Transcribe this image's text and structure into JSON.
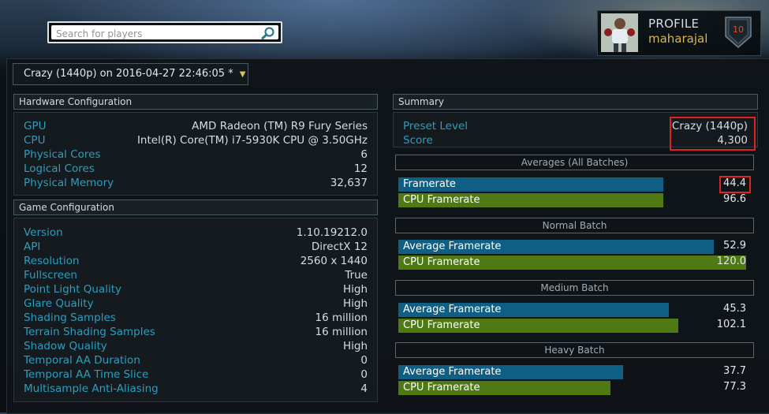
{
  "search": {
    "placeholder": "Search for players"
  },
  "profile": {
    "label": "PROFILE",
    "username": "maharajal",
    "level": "10"
  },
  "result_selector": {
    "value": "Crazy (1440p) on 2016-04-27 22:46:05 *"
  },
  "hardware": {
    "title": "Hardware Configuration",
    "rows": [
      {
        "key": "GPU",
        "value": "AMD Radeon (TM) R9 Fury Series"
      },
      {
        "key": "CPU",
        "value": "Intel(R) Core(TM) i7-5930K CPU @ 3.50GHz"
      },
      {
        "key": "Physical Cores",
        "value": "6"
      },
      {
        "key": "Logical Cores",
        "value": "12"
      },
      {
        "key": "Physical Memory",
        "value": "32,637"
      }
    ]
  },
  "game": {
    "title": "Game Configuration",
    "rows": [
      {
        "key": "Version",
        "value": "1.10.19212.0"
      },
      {
        "key": "API",
        "value": "DirectX 12"
      },
      {
        "key": "Resolution",
        "value": "2560 x 1440"
      },
      {
        "key": "Fullscreen",
        "value": "True"
      },
      {
        "key": "Point Light Quality",
        "value": "High"
      },
      {
        "key": "Glare Quality",
        "value": "High"
      },
      {
        "key": "Shading Samples",
        "value": "16 million"
      },
      {
        "key": "Terrain Shading Samples",
        "value": "16 million"
      },
      {
        "key": "Shadow Quality",
        "value": "High"
      },
      {
        "key": "Temporal AA Duration",
        "value": "0"
      },
      {
        "key": "Temporal AA Time Slice",
        "value": "0"
      },
      {
        "key": "Multisample Anti-Aliasing",
        "value": "4"
      }
    ]
  },
  "summary": {
    "title": "Summary",
    "preset_label": "Preset Level",
    "preset_value": "Crazy (1440p)",
    "score_label": "Score",
    "score_value": "4,300"
  },
  "batches": {
    "averages": {
      "title": "Averages (All Batches)",
      "fps_label": "Framerate",
      "fps": "44.4",
      "cpu_label": "CPU Framerate",
      "cpu": "96.6"
    },
    "normal": {
      "title": "Normal Batch",
      "fps_label": "Average Framerate",
      "fps": "52.9",
      "cpu_label": "CPU Framerate",
      "cpu": "120.0"
    },
    "medium": {
      "title": "Medium Batch",
      "fps_label": "Average Framerate",
      "fps": "45.3",
      "cpu_label": "CPU Framerate",
      "cpu": "102.1"
    },
    "heavy": {
      "title": "Heavy Batch",
      "fps_label": "Average Framerate",
      "fps": "37.7",
      "cpu_label": "CPU Framerate",
      "cpu": "77.3"
    }
  },
  "colors": {
    "accent_gold": "#d6b64d",
    "label_blue": "#2b9ec0",
    "bar_blue": "#0f5f85",
    "bar_green": "#4e7915",
    "highlight_red": "#e12222"
  }
}
